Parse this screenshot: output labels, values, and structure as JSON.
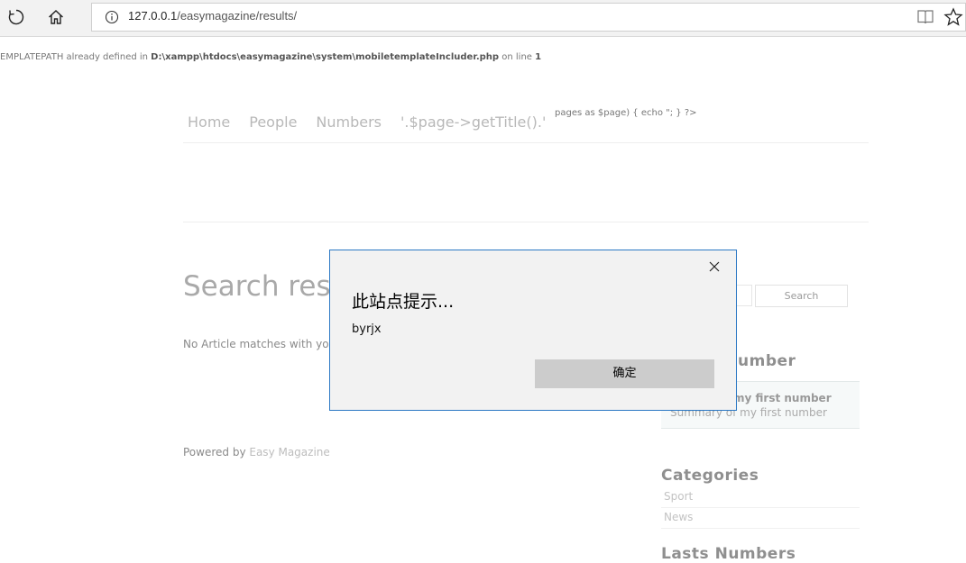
{
  "browser": {
    "url_host": "127.0.0.1",
    "url_path": "/easymagazine/results/"
  },
  "warning": {
    "prefix": "EMPLATEPATH already defined in ",
    "path": "D:\\xampp\\htdocs\\easymagazine\\system\\mobiletemplateIncluder.php",
    "mid": " on line ",
    "line": "1"
  },
  "nav": {
    "items": [
      "Home",
      "People",
      "Numbers",
      "'.$page->getTitle().'"
    ],
    "tail": "pages as $page) { echo \"; } ?>"
  },
  "main": {
    "title": "Search resu",
    "no_article": "No Article matches with yo",
    "powered_prefix": "Powered by ",
    "powered_link": "Easy Magazine"
  },
  "sidebar": {
    "search_button": "Search",
    "number_heading": "umber",
    "featured_title": "my first number",
    "featured_summary": "Summary of my first number",
    "categories_heading": "Categories",
    "categories": [
      "Sport",
      "News"
    ],
    "lasts_heading": "Lasts Numbers"
  },
  "dialog": {
    "title": "此站点提示...",
    "message": "byrjx",
    "ok_label": "确定"
  }
}
